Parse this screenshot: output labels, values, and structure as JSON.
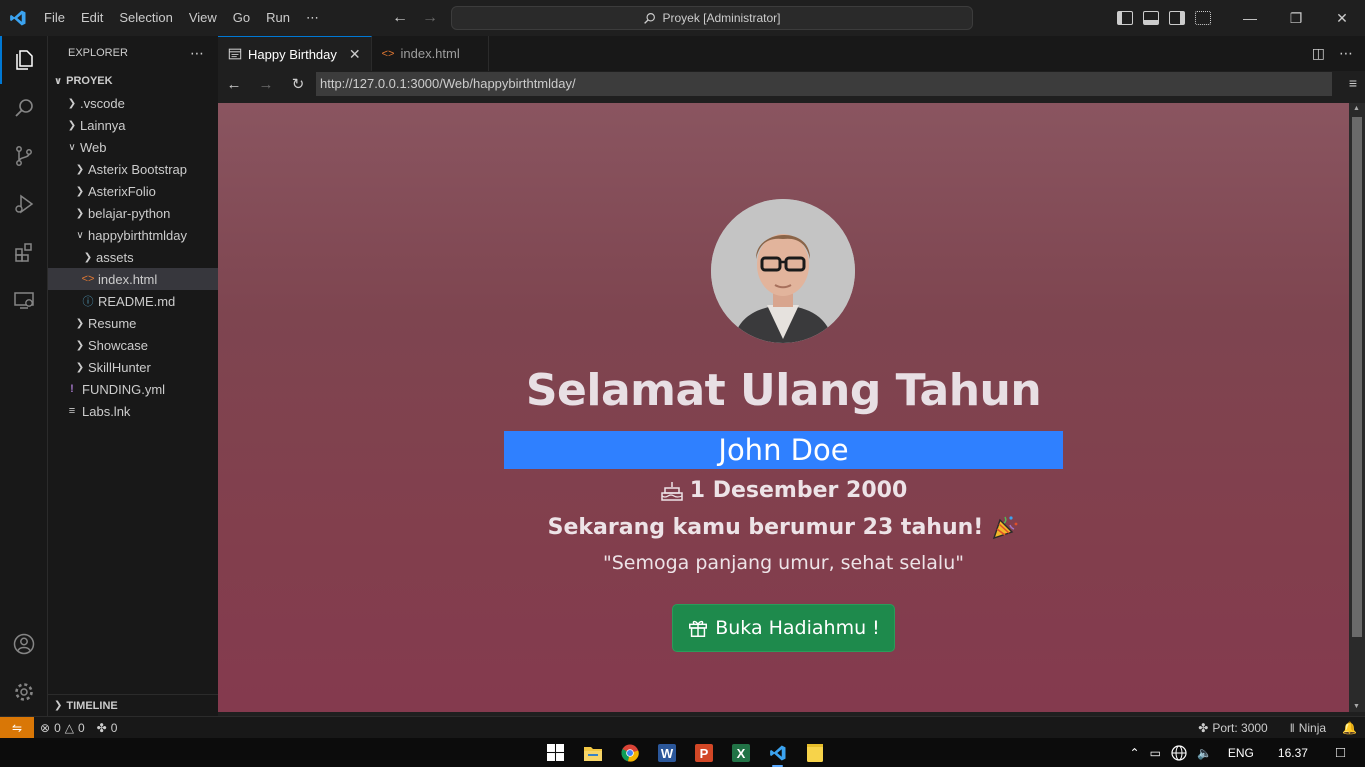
{
  "menu": [
    "File",
    "Edit",
    "Selection",
    "View",
    "Go",
    "Run"
  ],
  "menu_more": "⋯",
  "command_center": "Proyek [Administrator]",
  "explorer": {
    "title": "EXPLORER",
    "more": "⋯",
    "root": "PROYEK",
    "items": [
      {
        "label": ".vscode",
        "type": "folder-closed"
      },
      {
        "label": "Lainnya",
        "type": "folder-closed"
      },
      {
        "label": "Web",
        "type": "folder-open"
      },
      {
        "label": "Asterix Bootstrap",
        "type": "folder-closed"
      },
      {
        "label": "AsterixFolio",
        "type": "folder-closed"
      },
      {
        "label": "belajar-python",
        "type": "folder-closed"
      },
      {
        "label": "happybirthtmlday",
        "type": "folder-open"
      },
      {
        "label": "assets",
        "type": "folder-closed"
      },
      {
        "label": "index.html",
        "type": "html-file"
      },
      {
        "label": "README.md",
        "type": "info-file"
      },
      {
        "label": "Resume",
        "type": "folder-closed"
      },
      {
        "label": "Showcase",
        "type": "folder-closed"
      },
      {
        "label": "SkillHunter",
        "type": "folder-closed"
      },
      {
        "label": "FUNDING.yml",
        "type": "yaml-file"
      },
      {
        "label": "Labs.lnk",
        "type": "text-file"
      }
    ],
    "timeline": "TIMELINE"
  },
  "tabs": [
    {
      "label": "Happy Birthday",
      "icon": "preview-icon",
      "active": true
    },
    {
      "label": "index.html",
      "icon": "html-icon",
      "active": false
    }
  ],
  "browser": {
    "url": "http://127.0.0.1:3000/Web/happybirthtmlday/"
  },
  "page": {
    "greeting": "Selamat Ulang Tahun",
    "name": "John Doe",
    "birth_date": "1 Desember 2000",
    "age_text": "Sekarang kamu berumur 23 tahun!",
    "wish": "\"Semoga panjang umur, sehat selalu\"",
    "button": "Buka Hadiahmu !",
    "colors": {
      "name_bar": "#2f80ff",
      "button": "#1e8a4c"
    }
  },
  "status": {
    "errors": "0",
    "warnings": "0",
    "ports_count": "0",
    "port": "Port: 3000",
    "ninja": "Ninja"
  },
  "taskbar": {
    "lang": "ENG",
    "time": "16.37"
  },
  "colors": {
    "accent": "#0078d4",
    "remote": "#d97706"
  }
}
